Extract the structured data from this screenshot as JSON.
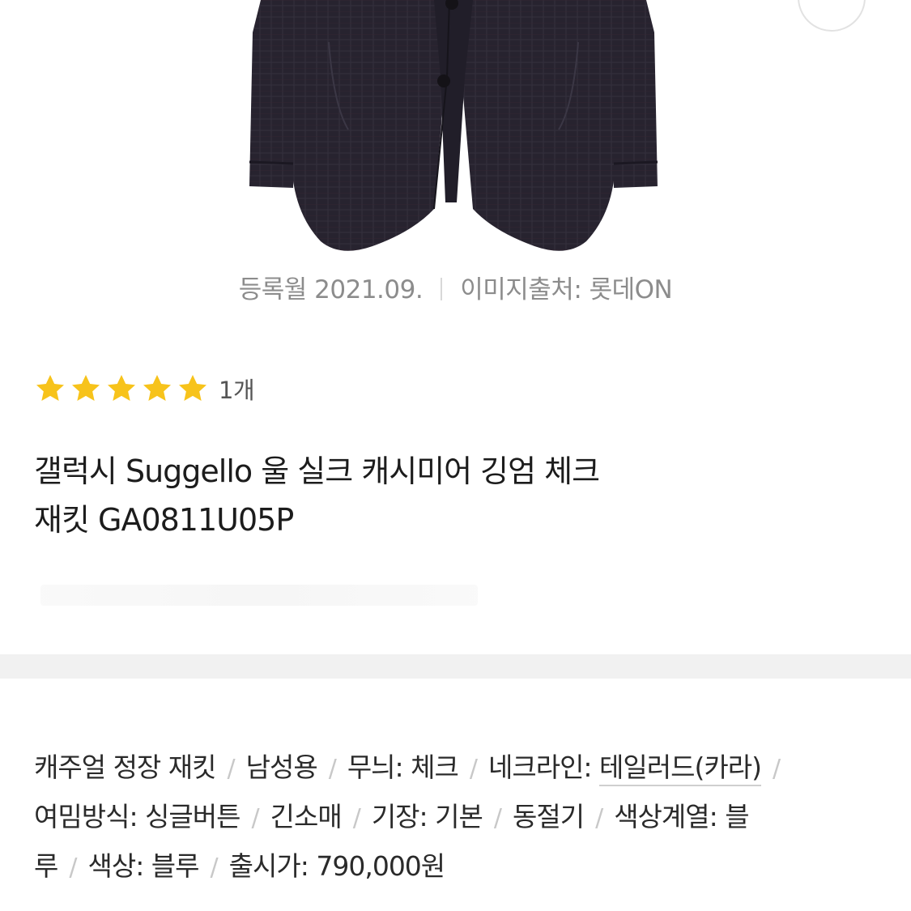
{
  "product": {
    "image_alt": "jacket",
    "registered": "등록월 2021.09.",
    "image_source": "이미지출처: 롯데ON",
    "rating": {
      "stars": 5,
      "max": 5,
      "count_label": "1개",
      "star_color": "#f7c31b"
    },
    "title_line1": "갤럭시 Suggello 울 실크 캐시미어 깅엄 체크",
    "title_line2": "재킷 GA0811U05P"
  },
  "specs": {
    "separator": "/",
    "lines": [
      [
        {
          "text": "캐주얼 정장 재킷",
          "link": false
        },
        {
          "text": "남성용",
          "link": false
        },
        {
          "text": "무늬: 체크",
          "link": false
        },
        {
          "text": "네크라인: ",
          "link": false,
          "suffix": "테일러드(카라)"
        }
      ],
      [
        {
          "text": "여밈방식: 싱글버튼",
          "link": false
        },
        {
          "text": "긴소매",
          "link": false
        },
        {
          "text": "기장: 기본",
          "link": false
        },
        {
          "text": "동절기",
          "link": false
        },
        {
          "text": "색상계열: 블",
          "link": false
        }
      ],
      [
        {
          "text": "루",
          "link": false
        },
        {
          "text": "색상: 블루",
          "link": false
        },
        {
          "text": "출시가: 790,000원",
          "link": false
        }
      ]
    ]
  },
  "colors": {
    "jacket": "#26222f",
    "jacket_shade": "#1b1822",
    "meta_text": "#8c8c8c",
    "divider": "#f1f1f1"
  }
}
